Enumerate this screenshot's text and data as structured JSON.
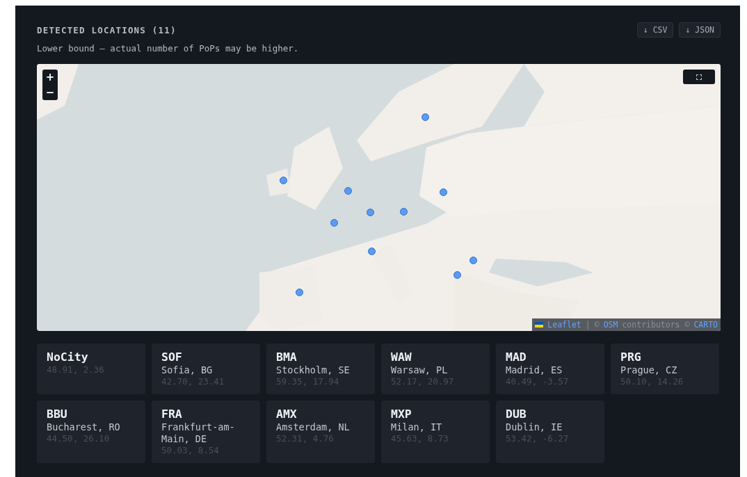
{
  "header": {
    "title": "DETECTED LOCATIONS (11)",
    "subtitle": "Lower bound — actual number of PoPs may be higher."
  },
  "exports": [
    "↓ CSV",
    "↓ JSON"
  ],
  "map": {
    "zoom_in": "+",
    "zoom_out": "−",
    "attribution": {
      "leaflet": "Leaflet",
      "separator": "|",
      "copyright": "©",
      "osm": "OSM",
      "contributors": "contributors ©",
      "carto": "CARTO"
    }
  },
  "locations": [
    {
      "code": "NoCity",
      "coords": "48.91, 2.36"
    },
    {
      "code": "SOF",
      "city": "Sofia, BG",
      "coords": "42.70, 23.41"
    },
    {
      "code": "BMA",
      "city": "Stockholm, SE",
      "coords": "59.35, 17.94"
    },
    {
      "code": "WAW",
      "city": "Warsaw, PL",
      "coords": "52.17, 20.97"
    },
    {
      "code": "MAD",
      "city": "Madrid, ES",
      "coords": "40.49, -3.57"
    },
    {
      "code": "PRG",
      "city": "Prague, CZ",
      "coords": "50.10, 14.26"
    },
    {
      "code": "BBU",
      "city": "Bucharest, RO",
      "coords": "44.50, 26.10"
    },
    {
      "code": "FRA",
      "city": "Frankfurt-am-Main, DE",
      "coords": "50.03, 8.54"
    },
    {
      "code": "AMX",
      "city": "Amsterdam, NL",
      "coords": "52.31, 4.76"
    },
    {
      "code": "MXP",
      "city": "Milan, IT",
      "coords": "45.63, 8.73"
    },
    {
      "code": "DUB",
      "city": "Dublin, IE",
      "coords": "53.42, -6.27"
    }
  ]
}
